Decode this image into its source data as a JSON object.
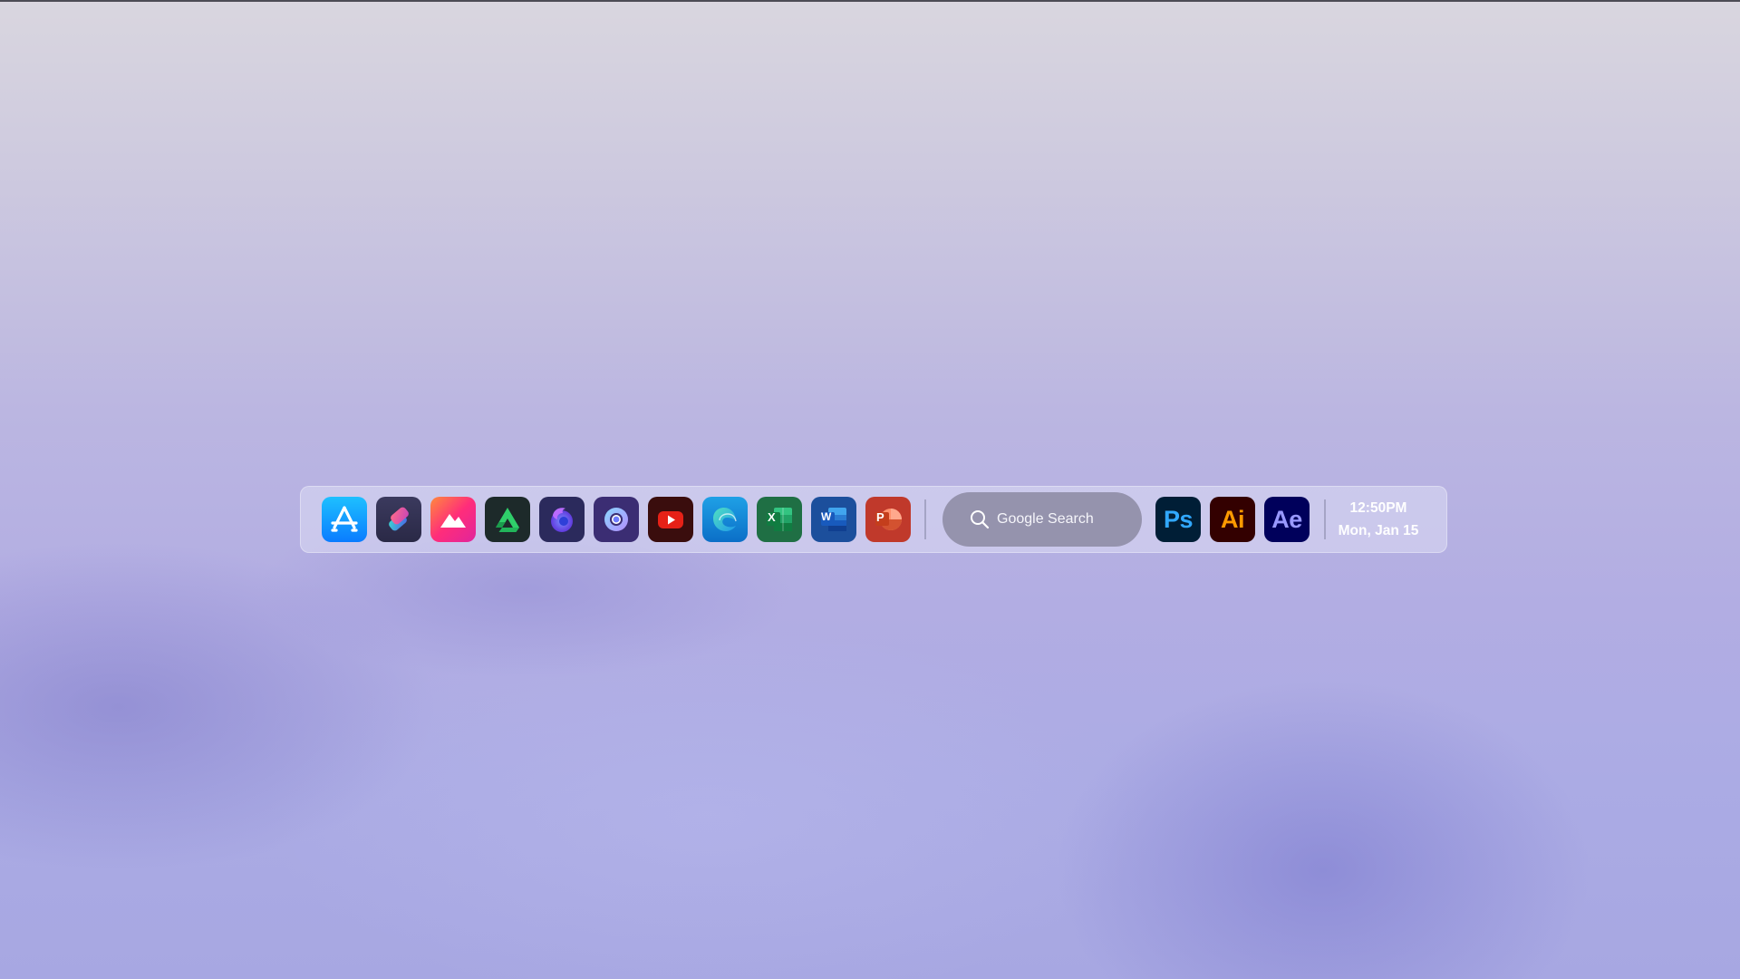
{
  "dock": {
    "left_apps": [
      {
        "name": "App Store",
        "icon": "app-store-icon"
      },
      {
        "name": "Shortcuts",
        "icon": "shortcuts-icon"
      },
      {
        "name": "Photos",
        "icon": "mountain-photo-icon"
      },
      {
        "name": "Google Drive",
        "icon": "drive-icon"
      },
      {
        "name": "Firefox",
        "icon": "firefox-icon"
      },
      {
        "name": "Chromium",
        "icon": "chromium-icon"
      },
      {
        "name": "YouTube",
        "icon": "youtube-icon"
      },
      {
        "name": "Microsoft Edge",
        "icon": "edge-icon"
      },
      {
        "name": "Excel",
        "icon": "excel-icon",
        "letter": "X"
      },
      {
        "name": "Word",
        "icon": "word-icon",
        "letter": "W"
      },
      {
        "name": "PowerPoint",
        "icon": "powerpoint-icon",
        "letter": "P"
      }
    ],
    "search": {
      "label": "Google Search",
      "icon": "search-icon"
    },
    "adobe_apps": [
      {
        "name": "Photoshop",
        "abbr": "Ps",
        "bg": "#001e36",
        "fg": "#31a8ff"
      },
      {
        "name": "Illustrator",
        "abbr": "Ai",
        "bg": "#330000",
        "fg": "#ff9a00"
      },
      {
        "name": "After Effects",
        "abbr": "Ae",
        "bg": "#00005b",
        "fg": "#9999ff"
      }
    ],
    "clock": {
      "time": "12:50PM",
      "date": "Mon, Jan 15"
    }
  },
  "colors": {
    "youtube_red": "#e62117",
    "excel_green": "#107c41",
    "word_blue": "#2b7cd3",
    "powerpoint_orange": "#d35230"
  }
}
